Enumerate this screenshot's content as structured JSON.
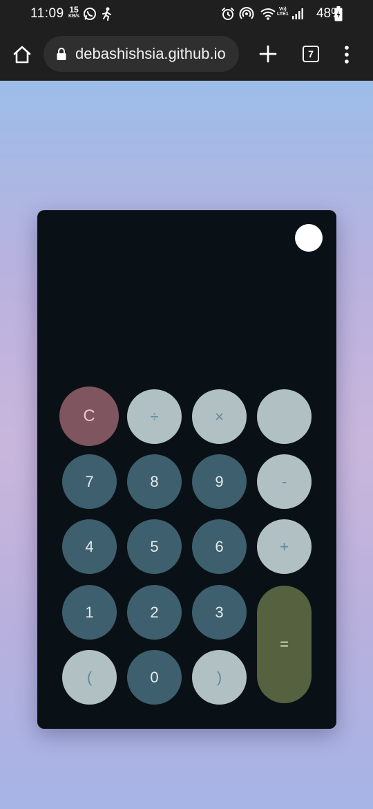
{
  "status_bar": {
    "time": "11:09",
    "net_speed_value": "15",
    "net_speed_unit": "KB/s",
    "left_icons": [
      "whatsapp-icon",
      "running-person-icon"
    ],
    "right_icons": [
      "alarm-icon",
      "hotspot-icon",
      "wifi-icon",
      "signal-icon",
      "battery-charging-icon"
    ],
    "lte_top": "Vo)",
    "lte_bottom": "LTE1",
    "battery": "48%"
  },
  "browser": {
    "url": "debashishsia.github.io",
    "tab_count": "7",
    "icons": [
      "home-icon",
      "lock-icon",
      "plus-icon",
      "kebab-menu-icon"
    ]
  },
  "calculator": {
    "display_value": "",
    "keys": {
      "clear": "C",
      "divide": "÷",
      "multiply": "×",
      "blank": "",
      "seven": "7",
      "eight": "8",
      "nine": "9",
      "minus": "-",
      "four": "4",
      "five": "5",
      "six": "6",
      "plus": "+",
      "one": "1",
      "two": "2",
      "three": "3",
      "equals": "=",
      "open_paren": "(",
      "zero": "0",
      "close_paren": ")"
    },
    "colors": {
      "panel": "#0a1116",
      "number_key": "#3e5f6d",
      "operator_key": "#b1c1c3",
      "clear_key": "#7f5560",
      "equals_key": "#56623f",
      "theme_toggle": "#ffffff"
    }
  }
}
